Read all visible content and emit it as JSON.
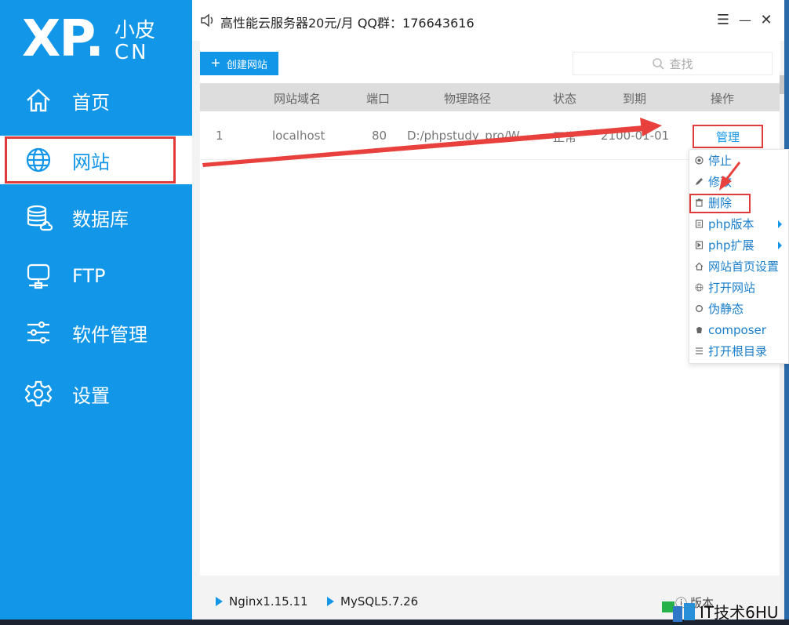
{
  "logo": {
    "main": "XP.",
    "sub_top": "小皮",
    "sub_bottom": "CN"
  },
  "sidebar": {
    "items": [
      {
        "label": "首页",
        "icon": "home-icon"
      },
      {
        "label": "网站",
        "icon": "globe-icon",
        "active": true
      },
      {
        "label": "数据库",
        "icon": "database-icon"
      },
      {
        "label": "FTP",
        "icon": "ftp-icon"
      },
      {
        "label": "软件管理",
        "icon": "sliders-icon"
      },
      {
        "label": "设置",
        "icon": "gear-icon"
      }
    ]
  },
  "titlebar": {
    "ad_text": "高性能云服务器20元/月  QQ群：176643616",
    "menu_glyph": "☰",
    "minimize_glyph": "—",
    "close_glyph": "✕"
  },
  "toolbar": {
    "create_label": "创建网站",
    "search_placeholder": "查找"
  },
  "table": {
    "headers": [
      "网站域名",
      "端口",
      "物理路径",
      "状态",
      "到期",
      "操作"
    ],
    "rows": [
      {
        "index": "1",
        "domain": "localhost",
        "port": "80",
        "path": "D:/phpstudy_pro/W",
        "status": "正常",
        "expire": "2100-01-01",
        "action": "管理"
      }
    ]
  },
  "dropdown": {
    "items": [
      {
        "label": "停止",
        "icon": "stop-icon"
      },
      {
        "label": "修改",
        "icon": "edit-icon"
      },
      {
        "label": "删除",
        "icon": "trash-icon"
      },
      {
        "label": "php版本",
        "icon": "php-version-icon",
        "submenu": true
      },
      {
        "label": "php扩展",
        "icon": "php-extension-icon",
        "submenu": true
      },
      {
        "label": "网站首页设置",
        "icon": "home-small-icon"
      },
      {
        "label": "打开网站",
        "icon": "web-icon"
      },
      {
        "label": "伪静态",
        "icon": "rewrite-icon"
      },
      {
        "label": "composer",
        "icon": "composer-icon"
      },
      {
        "label": "打开根目录",
        "icon": "list-icon"
      }
    ]
  },
  "footer": {
    "services": [
      "Nginx1.15.11",
      "MySQL5.7.26"
    ],
    "version_label": "版本"
  },
  "watermark": {
    "text": "IT技术6HU"
  },
  "colors": {
    "primary": "#1296e8",
    "highlight": "#e03a3a",
    "header_bg": "#dddddd"
  }
}
